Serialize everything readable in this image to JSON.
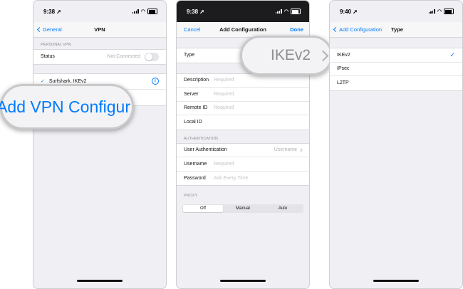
{
  "screen1": {
    "time": "9:38",
    "nav_back": "General",
    "nav_title": "VPN",
    "section_personal": "PERSONAL VPN",
    "status_label": "Status",
    "status_value": "Not Connected",
    "vpn_name": "Surfshark. IKEv2",
    "zoom_text": "Add VPN Configur"
  },
  "screen2": {
    "time": "9:38",
    "nav_cancel": "Cancel",
    "nav_title": "Add Configuration",
    "nav_done": "Done",
    "type_label": "Type",
    "type_zoom_value": "IKEv2",
    "fields": [
      {
        "label": "Description",
        "placeholder": "Required"
      },
      {
        "label": "Server",
        "placeholder": "Required"
      },
      {
        "label": "Remote ID",
        "placeholder": "Required"
      },
      {
        "label": "Local ID",
        "placeholder": ""
      }
    ],
    "section_auth": "AUTHENTICATION",
    "user_auth_label": "User Authentication",
    "user_auth_value": "Username",
    "username_label": "Username",
    "username_placeholder": "Required",
    "password_label": "Password",
    "password_placeholder": "Ask Every Time",
    "section_proxy": "PROXY",
    "proxy_options": [
      "Off",
      "Manual",
      "Auto"
    ],
    "proxy_selected": "Off"
  },
  "screen3": {
    "time": "9:40",
    "nav_back": "Add Configuration",
    "nav_title": "Type",
    "options": [
      "IKEv2",
      "IPsec",
      "L2TP"
    ],
    "selected": "IKEv2"
  },
  "colors": {
    "accent": "#007aff",
    "background": "#efeff4",
    "dark_status": "#1c1c1e"
  },
  "icons": [
    "chevron-left-icon",
    "chevron-right-icon",
    "info-icon",
    "checkmark-icon",
    "signal-icon",
    "wifi-icon",
    "battery-icon",
    "location-arrow-icon"
  ]
}
